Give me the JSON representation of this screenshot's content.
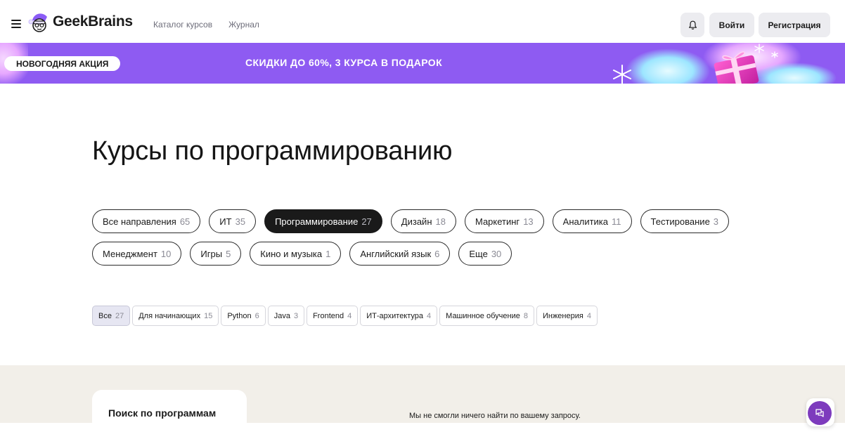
{
  "header": {
    "logo_text": "GeekBrains",
    "nav": [
      {
        "label": "Каталог курсов"
      },
      {
        "label": "Журнал"
      }
    ],
    "login_label": "Войти",
    "register_label": "Регистрация"
  },
  "banner": {
    "pill_label": "НОВОГОДНЯЯ АКЦИЯ",
    "text": "СКИДКИ ДО 60%, 3 КУРСА В ПОДАРОК"
  },
  "page": {
    "title": "Курсы по программированию"
  },
  "directions": [
    {
      "label": "Все направления",
      "count": "65"
    },
    {
      "label": "ИТ",
      "count": "35"
    },
    {
      "label": "Программирование",
      "count": "27",
      "active": true
    },
    {
      "label": "Дизайн",
      "count": "18"
    },
    {
      "label": "Маркетинг",
      "count": "13"
    },
    {
      "label": "Аналитика",
      "count": "11"
    },
    {
      "label": "Тестирование",
      "count": "3"
    },
    {
      "label": "Менеджмент",
      "count": "10"
    },
    {
      "label": "Игры",
      "count": "5"
    },
    {
      "label": "Кино и музыка",
      "count": "1"
    },
    {
      "label": "Английский язык",
      "count": "6"
    },
    {
      "label": "Еще",
      "count": "30"
    }
  ],
  "tags": [
    {
      "label": "Все",
      "count": "27",
      "active": true
    },
    {
      "label": "Для начинающих",
      "count": "15"
    },
    {
      "label": "Python",
      "count": "6"
    },
    {
      "label": "Java",
      "count": "3"
    },
    {
      "label": "Frontend",
      "count": "4"
    },
    {
      "label": "ИТ-архитектура",
      "count": "4"
    },
    {
      "label": "Машинное обучение",
      "count": "8"
    },
    {
      "label": "Инженерия",
      "count": "4"
    }
  ],
  "search_panel": {
    "title": "Поиск по программам"
  },
  "results": {
    "empty_message": "Мы не смогли ничего найти по вашему запросу."
  },
  "colors": {
    "banner": "#8e5bf2",
    "chip_active": "#1a1a1a",
    "lower_bg": "#f2efe9",
    "chat_fab": "#7d3bbd"
  },
  "icons": {
    "menu": "hamburger-icon",
    "logo": "geekbrains-logo-icon",
    "notifications": "bell-icon",
    "chat": "chat-icon"
  }
}
